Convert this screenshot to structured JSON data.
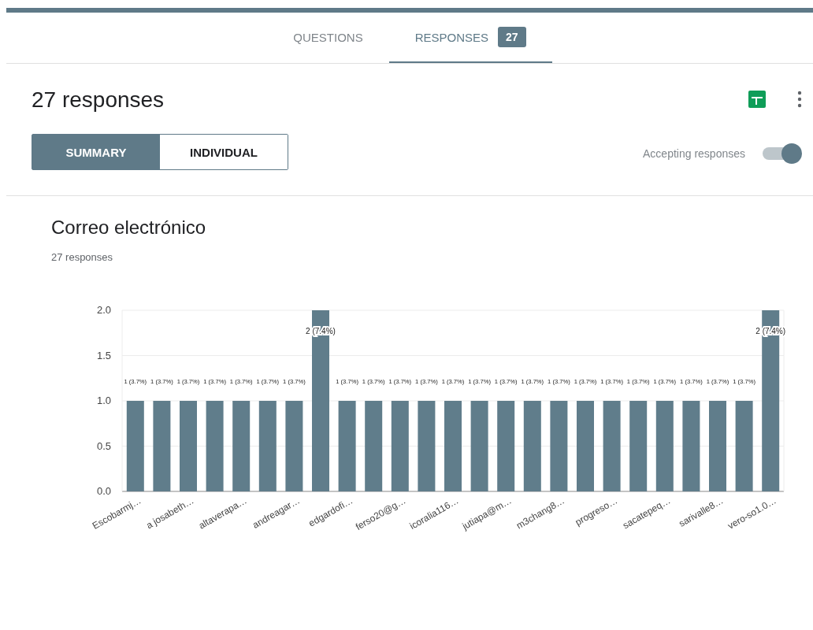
{
  "tabs": [
    {
      "label": "QUESTIONS",
      "selected": false
    },
    {
      "label": "RESPONSES",
      "selected": true,
      "badge": "27"
    }
  ],
  "header": {
    "title": "27 responses",
    "views": [
      {
        "label": "SUMMARY",
        "selected": true
      },
      {
        "label": "INDIVIDUAL",
        "selected": false
      }
    ],
    "accepting": {
      "label": "Accepting responses",
      "on": true
    }
  },
  "question": {
    "title": "Correo electrónico",
    "count": "27 responses",
    "chart_data": {
      "type": "bar",
      "categories": [
        "Escobarmj…",
        null,
        "a josabeth…",
        null,
        "altaverapa…",
        null,
        "andreagar…",
        null,
        "edgardofi…",
        null,
        "ferso20@g…",
        null,
        "icoralia116…",
        null,
        "jutiapa@m…",
        null,
        "m3chang8…",
        null,
        "progreso…",
        null,
        "sacatepeq…",
        null,
        "sarivalle8…",
        null,
        "vero-so1.0…"
      ],
      "values": [
        1,
        1,
        1,
        1,
        1,
        1,
        1,
        2,
        1,
        1,
        1,
        1,
        1,
        1,
        1,
        1,
        1,
        1,
        1,
        1,
        1,
        1,
        1,
        1,
        2
      ],
      "value_labels": [
        "1 (3.7%)",
        "1 (3.7%)",
        "1 (3.7%)",
        "1 (3.7%)",
        "1 (3.7%)",
        "1 (3.7%)",
        "1 (3.7%)",
        "2 (7.4%)",
        "1 (3.7%)",
        "1 (3.7%)",
        "1 (3.7%)",
        "1 (3.7%)",
        "1 (3.7%)",
        "1 (3.7%)",
        "1 (3.7%)",
        "1 (3.7%)",
        "1 (3.7%)",
        "1 (3.7%)",
        "1 (3.7%)",
        "1 (3.7%)",
        "1 (3.7%)",
        "1 (3.7%)",
        "1 (3.7%)",
        "1 (3.7%)",
        "2 (7.4%)"
      ],
      "ylim": [
        0,
        2
      ],
      "grid": true,
      "yticks": [
        {
          "value": 0,
          "label": "0.0"
        },
        {
          "value": 0.5,
          "label": "0.5"
        },
        {
          "value": 1,
          "label": "1.0"
        },
        {
          "value": 1.5,
          "label": "1.5"
        },
        {
          "value": 2,
          "label": "2.0"
        }
      ]
    }
  }
}
